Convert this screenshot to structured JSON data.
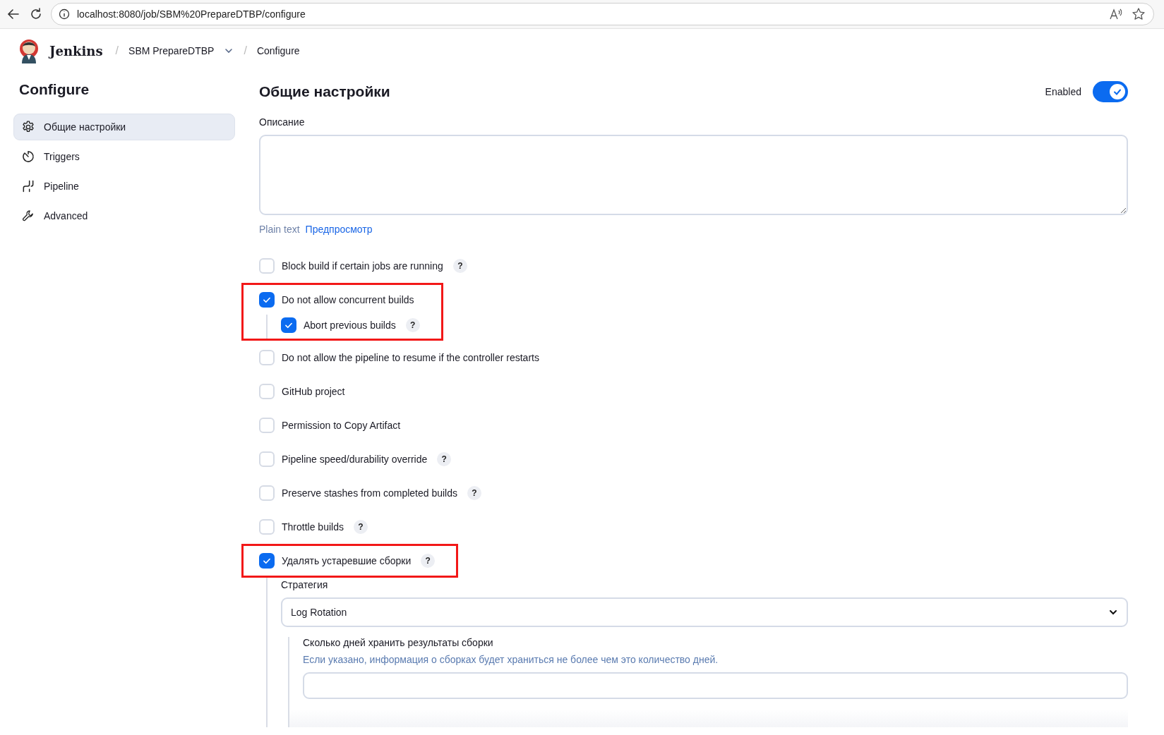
{
  "browser": {
    "url": "localhost:8080/job/SBM%20PrepareDTBP/configure"
  },
  "header": {
    "logo_text": "Jenkins",
    "breadcrumbs": [
      {
        "separator": "/",
        "label": "SBM PrepareDTBP",
        "dropdown": true
      },
      {
        "separator": "/",
        "label": "Configure",
        "dropdown": false
      }
    ]
  },
  "sidebar": {
    "title": "Configure",
    "items": [
      {
        "label": "Общие настройки",
        "selected": true
      },
      {
        "label": "Triggers",
        "selected": false
      },
      {
        "label": "Pipeline",
        "selected": false
      },
      {
        "label": "Advanced",
        "selected": false
      }
    ]
  },
  "main": {
    "title": "Общие настройки",
    "enabled": {
      "label": "Enabled",
      "on": true
    },
    "description": {
      "label": "Описание"
    },
    "format": {
      "plain_text": "Plain text",
      "preview_link": "Предпросмотр"
    },
    "options": [
      {
        "label": "Block build if certain jobs are running",
        "checked": false,
        "help": "?",
        "highlighted": false
      },
      {
        "label": "Do not allow concurrent builds",
        "checked": true,
        "highlighted": true,
        "children": [
          {
            "label": "Abort previous builds",
            "checked": true,
            "help": "?"
          }
        ]
      },
      {
        "label": "Do not allow the pipeline to resume if the controller restarts",
        "checked": false,
        "highlighted": false
      },
      {
        "label": "GitHub project",
        "checked": false,
        "highlighted": false
      },
      {
        "label": "Permission to Copy Artifact",
        "checked": false,
        "highlighted": false
      },
      {
        "label": "Pipeline speed/durability override",
        "checked": false,
        "help": "?",
        "highlighted": false
      },
      {
        "label": "Preserve stashes from completed builds",
        "checked": false,
        "help": "?",
        "highlighted": false
      },
      {
        "label": "Throttle builds",
        "checked": false,
        "help": "?",
        "highlighted": false
      },
      {
        "label": "Удалять устаревшие сборки",
        "checked": true,
        "help": "?",
        "highlighted": true,
        "details": {
          "strategy_label": "Стратегия",
          "strategy_value": "Log Rotation",
          "fields": [
            {
              "label": "Сколько дней хранить результаты сборки",
              "hint": "Если указано, информация о сборках будет храниться не более чем это количество дней."
            }
          ]
        }
      }
    ]
  }
}
